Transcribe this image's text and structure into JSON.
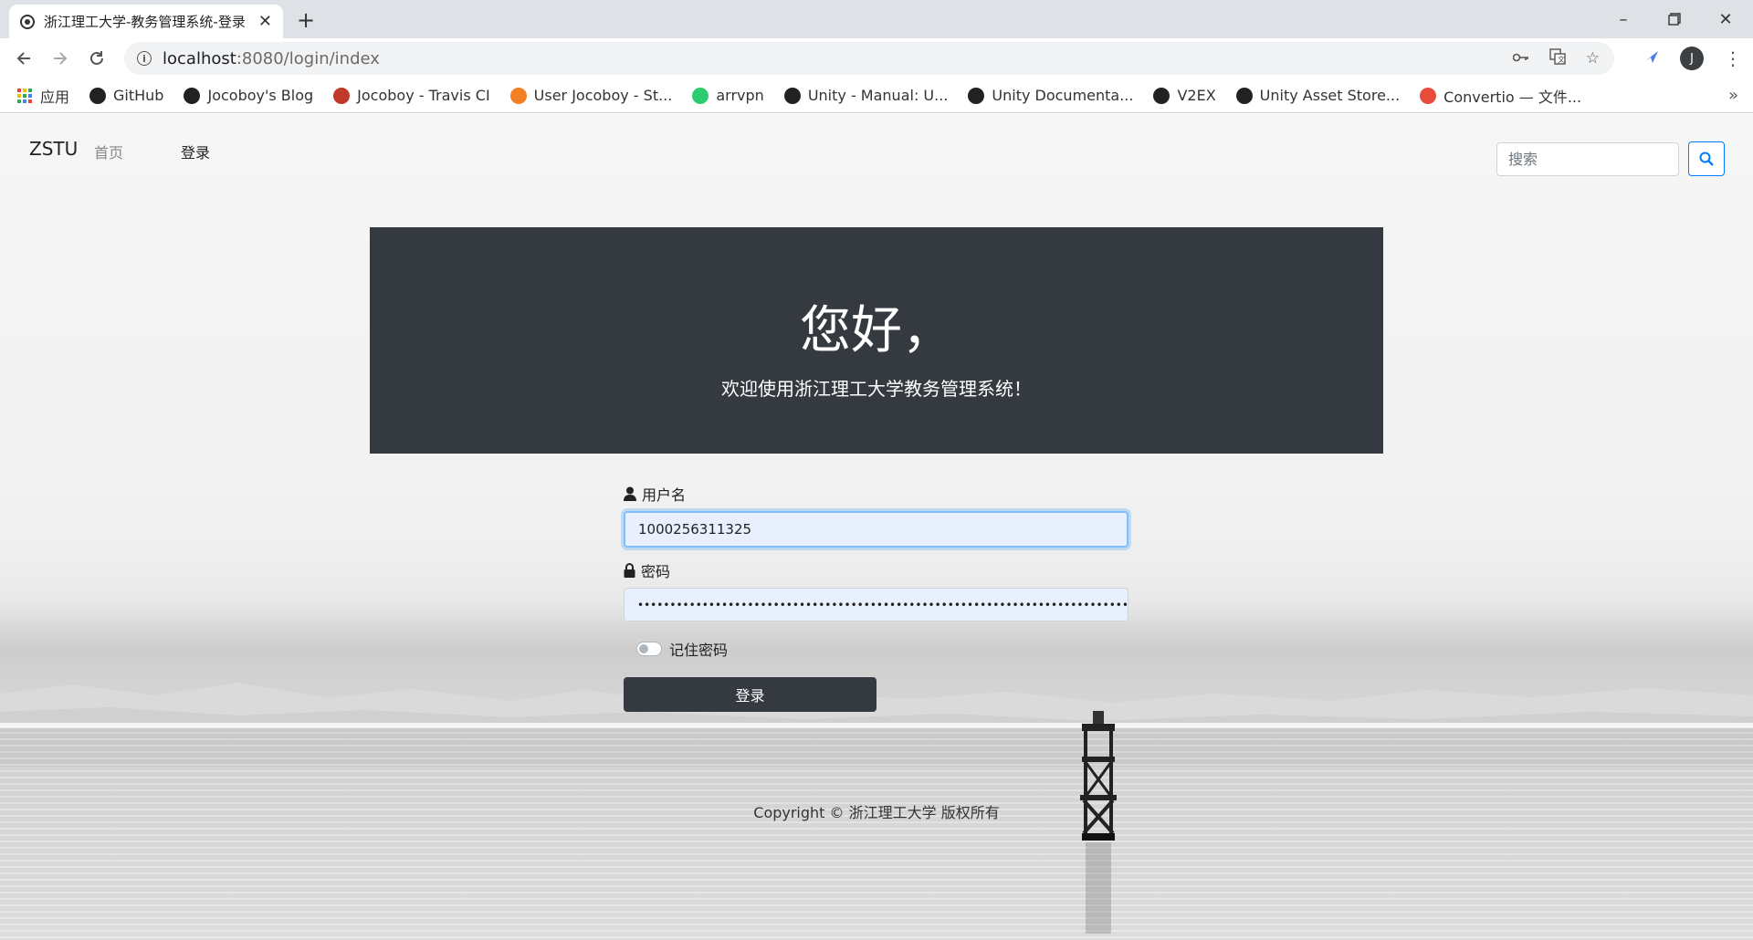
{
  "browser": {
    "tab_title": "浙江理工大学-教务管理系统-登录",
    "url_host": "localhost",
    "url_path": ":8080/login/index",
    "bookmarks": [
      {
        "label": "应用",
        "icon": "apps-grid-icon",
        "color": "#4285f4"
      },
      {
        "label": "GitHub",
        "icon": "github-icon",
        "color": "#222222"
      },
      {
        "label": "Jocoboy's Blog",
        "icon": "blog-icon",
        "color": "#222222"
      },
      {
        "label": "Jocoboy - Travis CI",
        "icon": "travis-icon",
        "color": "#c0392b"
      },
      {
        "label": "User Jocoboy - St...",
        "icon": "stackoverflow-icon",
        "color": "#f48024"
      },
      {
        "label": "arrvpn",
        "icon": "arrvpn-icon",
        "color": "#2ecc71"
      },
      {
        "label": "Unity - Manual: U...",
        "icon": "unity-icon",
        "color": "#222222"
      },
      {
        "label": "Unity Documenta...",
        "icon": "unity-doc-icon",
        "color": "#222222"
      },
      {
        "label": "V2EX",
        "icon": "v2ex-icon",
        "color": "#222222"
      },
      {
        "label": "Unity Asset Store...",
        "icon": "unity-store-icon",
        "color": "#222222"
      },
      {
        "label": "Convertio — 文件...",
        "icon": "convertio-icon",
        "color": "#e74c3c"
      }
    ],
    "profile_initial": "J"
  },
  "navbar": {
    "brand": "ZSTU",
    "home": "首页",
    "login": "登录",
    "search_placeholder": "搜索"
  },
  "hero": {
    "title": "您好，",
    "subtitle": "欢迎使用浙江理工大学教务管理系统！"
  },
  "form": {
    "username_label": "用户名",
    "username_value": "1000256311325",
    "password_label": "密码",
    "password_value": "••••••••••••••••••••••••••••••••••••••••••••••••••••••••••••••••••••••••••••••••••••••••••••",
    "remember_label": "记住密码",
    "remember_checked": false,
    "submit_label": "登录"
  },
  "footer": {
    "copyright": "Copyright © 浙江理工大学 版权所有"
  }
}
